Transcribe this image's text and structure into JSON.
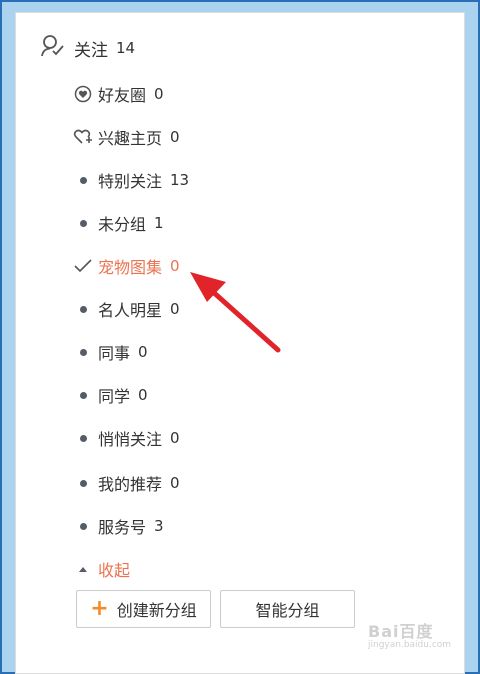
{
  "colors": {
    "accent": "#eb7350",
    "arrow": "#e0242a",
    "frame": "#2a6fb5",
    "bullet": "#555c66"
  },
  "header": {
    "label": "关注",
    "count": "14",
    "icon": "user-check-icon"
  },
  "groups": [
    {
      "label": "好友圈",
      "count": "0",
      "icon": "heart-circle-icon"
    },
    {
      "label": "兴趣主页",
      "count": "0",
      "icon": "heart-plus-icon"
    },
    {
      "label": "特别关注",
      "count": "13",
      "icon": "bullet"
    },
    {
      "label": "未分组",
      "count": "1",
      "icon": "bullet"
    },
    {
      "label": "宠物图集",
      "count": "0",
      "icon": "check-icon",
      "selected": true
    },
    {
      "label": "名人明星",
      "count": "0",
      "icon": "bullet"
    },
    {
      "label": "同事",
      "count": "0",
      "icon": "bullet"
    },
    {
      "label": "同学",
      "count": "0",
      "icon": "bullet"
    },
    {
      "label": "悄悄关注",
      "count": "0",
      "icon": "bullet"
    },
    {
      "label": "我的推荐",
      "count": "0",
      "icon": "bullet"
    },
    {
      "label": "服务号",
      "count": "3",
      "icon": "bullet"
    }
  ],
  "collapse": {
    "label": "收起",
    "icon": "caret-up-icon"
  },
  "buttons": {
    "create_group": "创建新分组",
    "smart_group": "智能分组"
  },
  "watermark": {
    "logo": "Bai百度",
    "sub": "jingyan.baidu.com"
  }
}
